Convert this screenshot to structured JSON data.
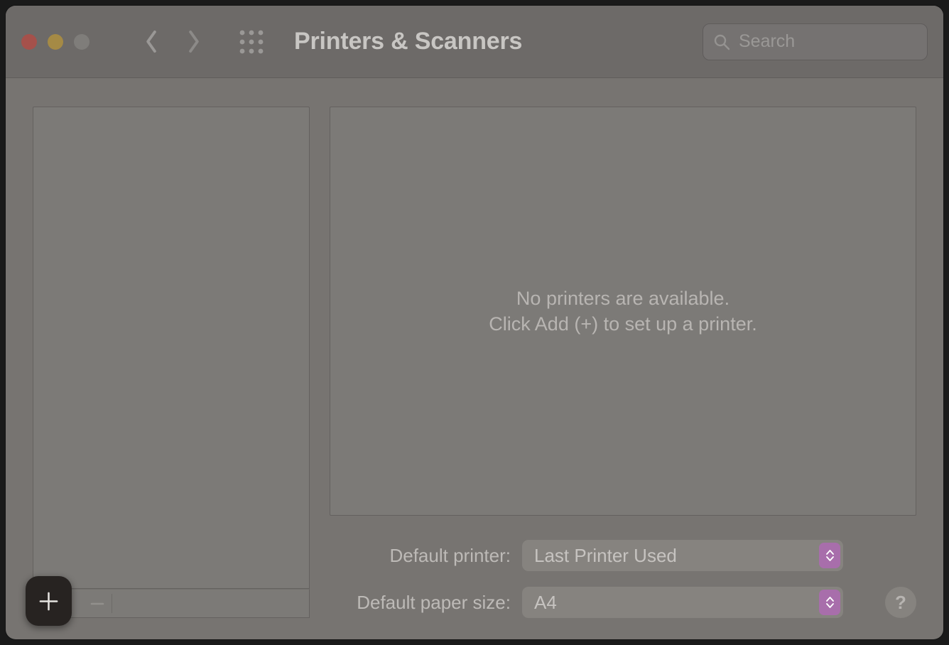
{
  "header": {
    "title": "Printers & Scanners",
    "search_placeholder": "Search"
  },
  "main": {
    "empty_line1": "No printers are available.",
    "empty_line2": "Click Add (+) to set up a printer."
  },
  "settings": {
    "default_printer_label": "Default printer:",
    "default_printer_value": "Last Printer Used",
    "default_paper_label": "Default paper size:",
    "default_paper_value": "A4"
  },
  "help_glyph": "?"
}
